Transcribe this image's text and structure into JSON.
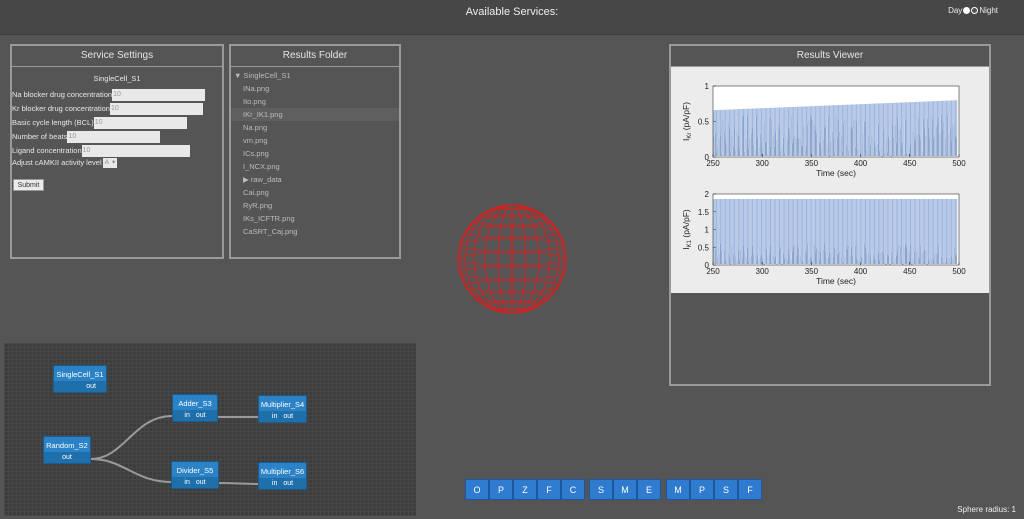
{
  "header": {
    "title": "Available Services:",
    "day_label": "Day",
    "night_label": "Night"
  },
  "settings": {
    "title": "Service Settings",
    "subtitle": "SingleCell_S1",
    "fields": [
      {
        "label": "Na blocker drug concentration",
        "value": "10"
      },
      {
        "label": "Kr blocker drug concentration",
        "value": "10"
      },
      {
        "label": "Basic cycle length (BCL)",
        "value": "10"
      },
      {
        "label": "Number of beats",
        "value": "10"
      },
      {
        "label": "Ligand concentration",
        "value": "10"
      }
    ],
    "select_label": "Adjust cAMKII activity level",
    "select_value": "A",
    "submit_label": "Submit"
  },
  "folder": {
    "title": "Results Folder",
    "root": "SingleCell_S1",
    "items": [
      "INa.png",
      "Ito.png",
      "IKr_IK1.png",
      "Na.png",
      "vm.png",
      "ICs.png",
      "I_NCX.png",
      "raw_data",
      "Cai.png",
      "RyR.png",
      "IKs_ICFTR.png",
      "CaSRT_Caj.png"
    ]
  },
  "viewer": {
    "title": "Results Viewer",
    "charts": [
      {
        "ylabel_main": "I",
        "ylabel_sub": "Kr",
        "ylabel_unit": " (pA/pF)",
        "yticks": [
          "0",
          "0.5",
          "1"
        ],
        "ymax": 1
      },
      {
        "ylabel_main": "I",
        "ylabel_sub": "K1",
        "ylabel_unit": " (pA/pF)",
        "yticks": [
          "0",
          "0.5",
          "1",
          "1.5",
          "2"
        ],
        "ymax": 2
      }
    ],
    "xticks": [
      "250",
      "300",
      "350",
      "400",
      "450",
      "500"
    ],
    "xlabel": "Time (sec)"
  },
  "workflow": {
    "nodes": [
      {
        "name": "SingleCell_S1",
        "ports": "out"
      },
      {
        "name": "Random_S2",
        "ports": "out"
      },
      {
        "name": "Adder_S3",
        "ports_in": "in",
        "ports_out": "out"
      },
      {
        "name": "Multiplier_S4",
        "ports_in": "in",
        "ports_out": "out"
      },
      {
        "name": "Divider_S5",
        "ports_in": "in",
        "ports_out": "out"
      },
      {
        "name": "Multiplier_S6",
        "ports_in": "in",
        "ports_out": "out"
      }
    ]
  },
  "buttons": {
    "group1": [
      "O",
      "P",
      "Z",
      "F",
      "C"
    ],
    "group2": [
      "S",
      "M",
      "E"
    ],
    "group3": [
      "M",
      "P",
      "S",
      "F"
    ]
  },
  "status": {
    "sphere_radius": "Sphere radius: 1"
  },
  "colors": {
    "accent": "#2f7bd0",
    "node": "#2b82c7",
    "sphere": "#d42020",
    "plot": "#4a78c2"
  }
}
